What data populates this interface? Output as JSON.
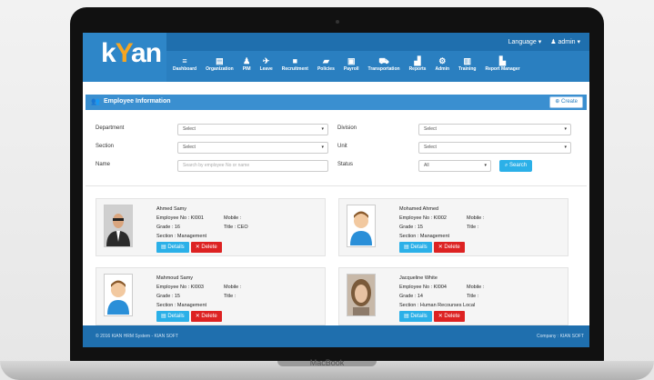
{
  "device": {
    "brand": "MacBook"
  },
  "app": {
    "logo": {
      "prefix": "k",
      "accent": "Y",
      "suffix": "an"
    },
    "user_menu": {
      "language": "Language ▾",
      "user": "♟ admin ▾"
    }
  },
  "nav": [
    {
      "label": "Dashboard",
      "icon": "menu-icon",
      "glyph": "≡"
    },
    {
      "label": "Organization",
      "icon": "document-icon",
      "glyph": "▤"
    },
    {
      "label": "PIM",
      "icon": "person-icon",
      "glyph": "♟"
    },
    {
      "label": "Leave",
      "icon": "plane-icon",
      "glyph": "✈"
    },
    {
      "label": "Recruitment",
      "icon": "briefcase-icon",
      "glyph": "■"
    },
    {
      "label": "Policies",
      "icon": "book-icon",
      "glyph": "▰"
    },
    {
      "label": "Payroll",
      "icon": "money-icon",
      "glyph": "▣"
    },
    {
      "label": "Transportation",
      "icon": "car-icon",
      "glyph": "⛟"
    },
    {
      "label": "Reports",
      "icon": "bar-chart-icon",
      "glyph": "▟"
    },
    {
      "label": "Admin",
      "icon": "gears-icon",
      "glyph": "⚙"
    },
    {
      "label": "Training",
      "icon": "training-icon",
      "glyph": "▥"
    },
    {
      "label": "Report Manager",
      "icon": "chart-icon",
      "glyph": "▙"
    }
  ],
  "panel": {
    "title": "Employee Information",
    "create_label": "Create"
  },
  "filters": {
    "department": {
      "label": "Department",
      "value": "Select"
    },
    "division": {
      "label": "Division",
      "value": "Select"
    },
    "section": {
      "label": "Section",
      "value": "Select"
    },
    "unit": {
      "label": "Unit",
      "value": "Select"
    },
    "name": {
      "label": "Name",
      "placeholder": "Search by employee No or name"
    },
    "status": {
      "label": "Status",
      "value": "All"
    },
    "search_label": "Search"
  },
  "employees": [
    {
      "name": "Ahmed Samy",
      "employee_no": "Employee No : KI001",
      "mobile": "Mobile :",
      "grade": "Grade : 16",
      "title": "Title : CEO",
      "section": "Section : Management",
      "photo": "photo-man-suit"
    },
    {
      "name": "Mohamed Ahmed",
      "employee_no": "Employee No : KI002",
      "mobile": "Mobile :",
      "grade": "Grade : 15",
      "title": "Title :",
      "section": "Section : Management",
      "photo": "avatar-placeholder"
    },
    {
      "name": "Mahmoud Samy",
      "employee_no": "Employee No : KI003",
      "mobile": "Mobile :",
      "grade": "Grade : 15",
      "title": "Title :",
      "section": "Section : Management",
      "photo": "avatar-placeholder"
    },
    {
      "name": "Jacqueline White",
      "employee_no": "Employee No : KI004",
      "mobile": "Mobile :",
      "grade": "Grade : 14",
      "title": "Title :",
      "section": "Section : Human Recourses Local",
      "photo": "photo-woman"
    }
  ],
  "card_buttons": {
    "details": "Details",
    "delete": "Delete"
  },
  "footer": {
    "left": "© 2016 KIAN HRM System - KIAN SOFT",
    "right": "Company : KIAN SOFT"
  },
  "colors": {
    "nav_blue": "#2a7fc0",
    "accent_orange": "#f5a623",
    "details_blue": "#2bb0e8",
    "delete_red": "#dd2222"
  }
}
